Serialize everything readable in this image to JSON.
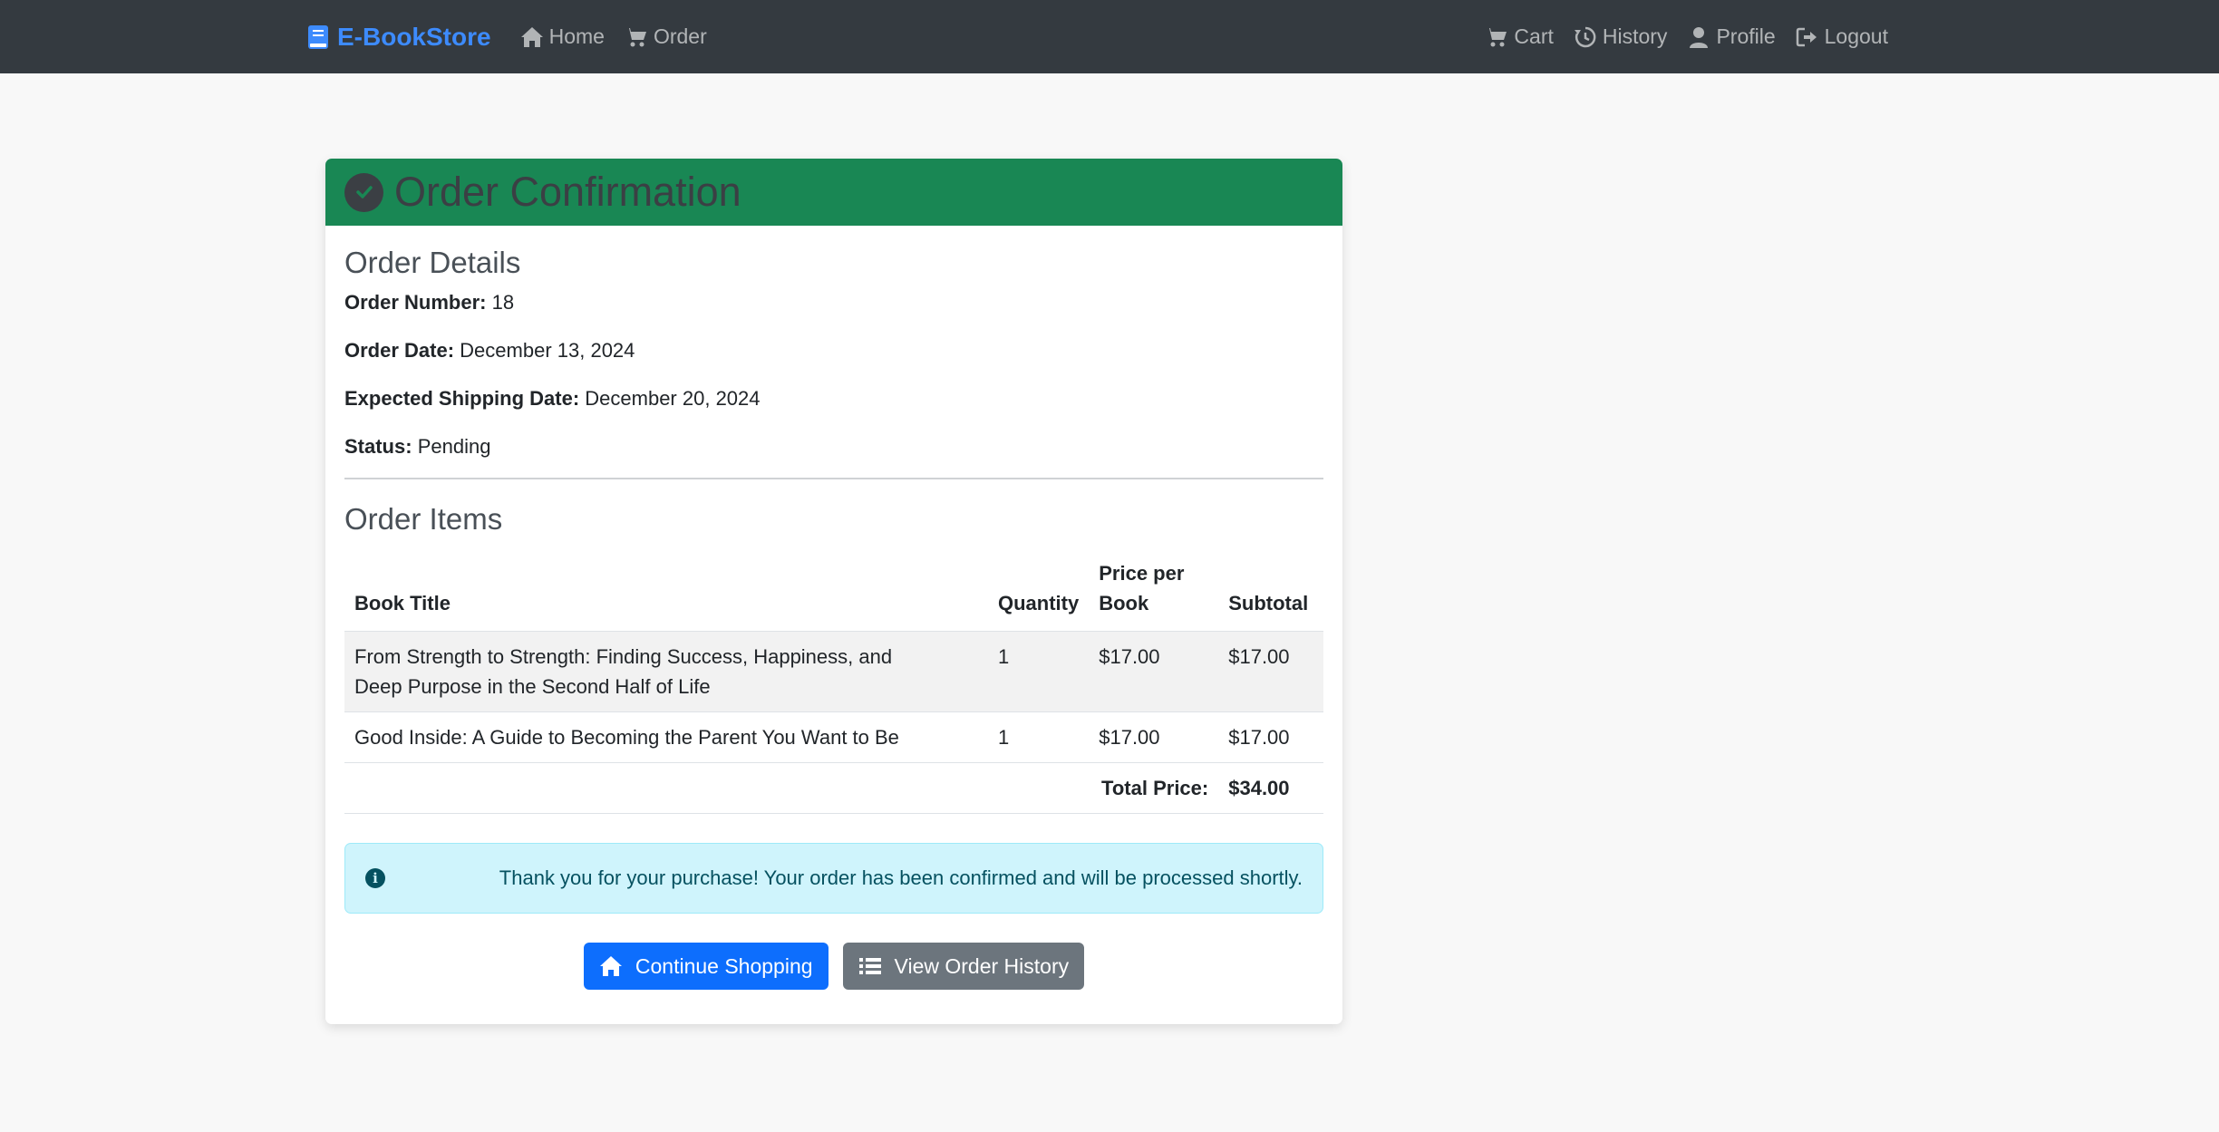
{
  "navbar": {
    "brand": "E-BookStore",
    "left_links": [
      {
        "label": "Home",
        "icon": "home-icon"
      },
      {
        "label": "Order",
        "icon": "cart-icon"
      }
    ],
    "right_links": [
      {
        "label": "Cart",
        "icon": "cart-icon"
      },
      {
        "label": "History",
        "icon": "history-icon"
      },
      {
        "label": "Profile",
        "icon": "user-icon"
      },
      {
        "label": "Logout",
        "icon": "logout-icon"
      }
    ]
  },
  "card": {
    "title": "Order Confirmation",
    "details_heading": "Order Details",
    "details": [
      {
        "label": "Order Number:",
        "value": "18"
      },
      {
        "label": "Order Date:",
        "value": "December 13, 2024"
      },
      {
        "label": "Expected Shipping Date:",
        "value": "December 20, 2024"
      },
      {
        "label": "Status:",
        "value": "Pending"
      }
    ],
    "items_heading": "Order Items",
    "table": {
      "headers": [
        "Book Title",
        "Quantity",
        "Price per Book",
        "Subtotal"
      ],
      "rows": [
        {
          "title": "From Strength to Strength: Finding Success, Happiness, and Deep Purpose in the Second Half of Life",
          "quantity": "1",
          "price": "$17.00",
          "subtotal": "$17.00"
        },
        {
          "title": "Good Inside: A Guide to Becoming the Parent You Want to Be",
          "quantity": "1",
          "price": "$17.00",
          "subtotal": "$17.00"
        }
      ],
      "total_label": "Total Price:",
      "total_value": "$34.00"
    },
    "alert": "Thank you for your purchase! Your order has been confirmed and will be processed shortly.",
    "buttons": {
      "continue": "Continue Shopping",
      "history": "View Order History"
    }
  },
  "colors": {
    "navbar_bg": "#343a40",
    "brand": "#3d8bfd",
    "header_green": "#198754",
    "primary": "#0d6efd",
    "secondary": "#6c757d",
    "alert_bg": "#cff4fc"
  }
}
